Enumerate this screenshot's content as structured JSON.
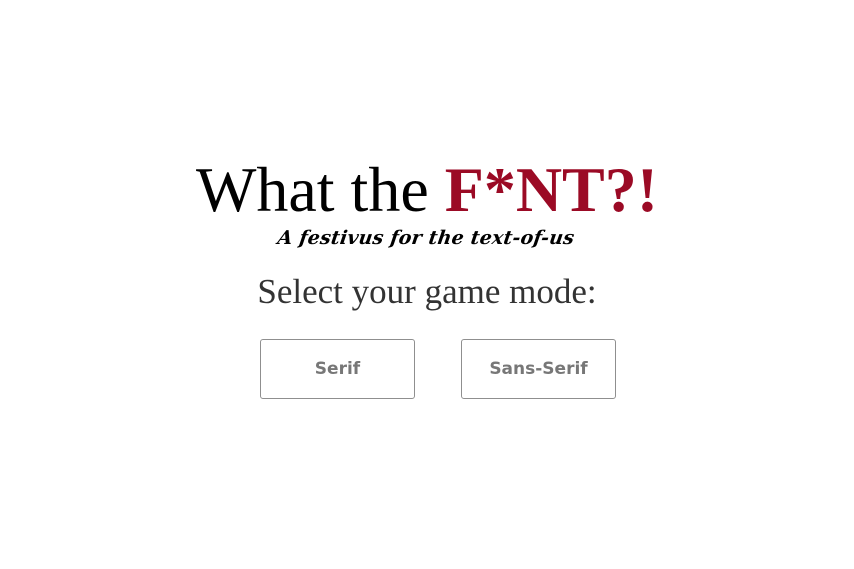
{
  "header": {
    "title_prefix": "What the ",
    "title_accent": "F*NT?!",
    "tagline": "A festivus for the text-of-us"
  },
  "main": {
    "prompt": "Select your game mode:",
    "modes": [
      {
        "label": "Serif"
      },
      {
        "label": "Sans-Serif"
      }
    ]
  },
  "colors": {
    "accent": "#9b0a25",
    "text": "#000000",
    "prompt_text": "#333333",
    "button_text": "#777777",
    "button_border": "#8f8f8f",
    "background": "#ffffff"
  }
}
